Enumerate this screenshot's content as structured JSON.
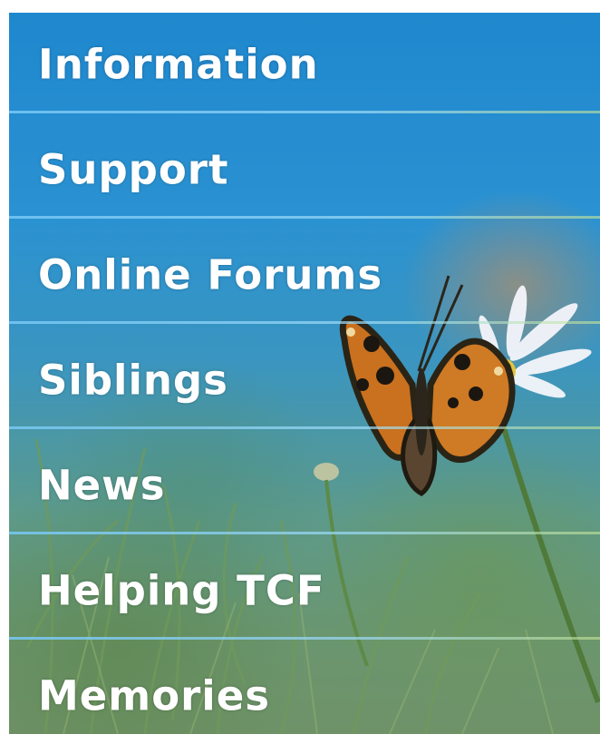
{
  "menu": {
    "items": [
      {
        "label": "Information",
        "name": "menu-item-information"
      },
      {
        "label": "Support",
        "name": "menu-item-support"
      },
      {
        "label": "Online Forums",
        "name": "menu-item-online-forums"
      },
      {
        "label": "Siblings",
        "name": "menu-item-siblings"
      },
      {
        "label": "News",
        "name": "menu-item-news"
      },
      {
        "label": "Helping TCF",
        "name": "menu-item-helping-tcf"
      },
      {
        "label": "Memories",
        "name": "menu-item-memories"
      }
    ]
  },
  "colors": {
    "background_top": "#1f87cd",
    "background_bottom": "#6f9268",
    "label": "#ffffff",
    "divider": "#8fd0f5"
  },
  "background_image": {
    "subject": "butterfly-on-daisy-photo"
  }
}
